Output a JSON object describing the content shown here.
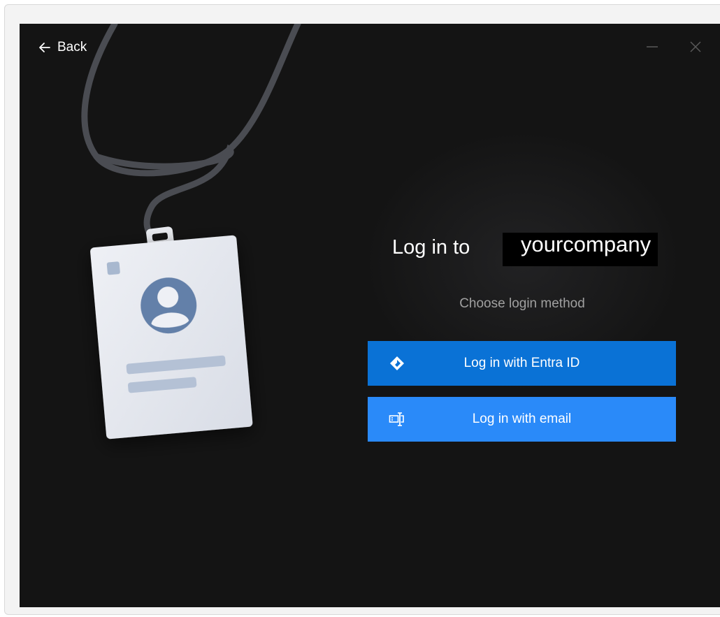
{
  "window": {
    "back_label": "Back",
    "minimize_icon": "minimize-icon",
    "close_icon": "close-icon"
  },
  "illustration": {
    "icon": "id-badge-icon"
  },
  "login": {
    "title_prefix": "Log in to",
    "company_name": "yourcompany",
    "subtitle": "Choose login method",
    "buttons": [
      {
        "label": "Log in with Entra ID",
        "icon": "entra-id-icon",
        "color": "#0a72d6"
      },
      {
        "label": "Log in with email",
        "icon": "email-icon",
        "color": "#2a8af9"
      }
    ]
  },
  "colors": {
    "background": "#141414",
    "primary": "#0a72d6",
    "secondary": "#2a8af9",
    "subtitle": "#a0a0a0"
  }
}
